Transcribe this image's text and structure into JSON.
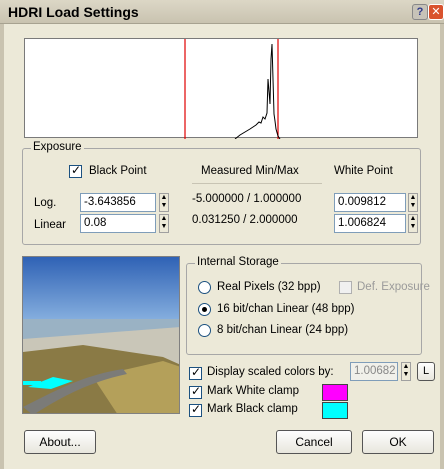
{
  "window": {
    "title": "HDRI Load Settings",
    "help_glyph": "?",
    "close_glyph": "✕"
  },
  "exposure": {
    "group_label": "Exposure",
    "black_point_label": "Black Point",
    "black_point_checked": true,
    "measured_header": "Measured Min/Max",
    "white_point_header": "White Point",
    "log_label": "Log.",
    "linear_label": "Linear",
    "black_log": "-3.643856",
    "black_linear": "0.08",
    "measured_log": "-5.000000 / 1.000000",
    "measured_linear": "0.031250 / 2.000000",
    "white_log": "0.009812",
    "white_linear": "1.006824"
  },
  "storage": {
    "group_label": "Internal Storage",
    "options": [
      {
        "label": "Real Pixels (32 bpp)",
        "checked": false
      },
      {
        "label": "16 bit/chan Linear (48 bpp)",
        "checked": true
      },
      {
        "label": "8 bit/chan Linear (24 bpp)",
        "checked": false
      }
    ],
    "def_exposure_label": "Def. Exposure",
    "def_exposure_checked": false
  },
  "display": {
    "scaled_colors_label": "Display scaled colors by:",
    "scaled_colors_checked": true,
    "scaled_value": "1.00682",
    "lock_label": "L",
    "mark_white_label": "Mark White clamp",
    "mark_white_checked": true,
    "mark_white_color": "#ff00ff",
    "mark_black_label": "Mark Black clamp",
    "mark_black_checked": true,
    "mark_black_color": "#00ffff"
  },
  "buttons": {
    "about": "About...",
    "cancel": "Cancel",
    "ok": "OK"
  },
  "colors": {
    "histogram_marker": "#e00000"
  }
}
